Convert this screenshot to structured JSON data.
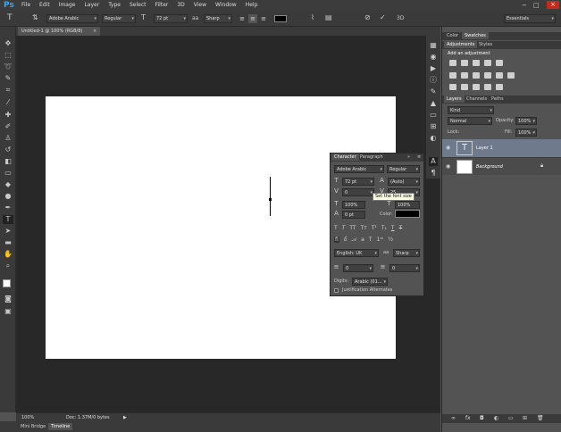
{
  "app": {
    "logo": "Ps"
  },
  "menu": [
    "File",
    "Edit",
    "Image",
    "Layer",
    "Type",
    "Select",
    "Filter",
    "3D",
    "View",
    "Window",
    "Help"
  ],
  "options_bar": {
    "font_family": "Adobe Arabic",
    "font_style": "Regular",
    "font_size": "72 pt",
    "aa_label": "aa",
    "anti_alias": "Sharp",
    "three_d": "3D",
    "workspace": "Essentials"
  },
  "document": {
    "tab_title": "Untitled-1 @ 100% (RGB/8)"
  },
  "status": {
    "zoom": "100%",
    "doc_info": "Doc: 1.37M/0 bytes"
  },
  "bottom_tabs": [
    "Mini Bridge",
    "Timeline"
  ],
  "color_panel": {
    "tabs": [
      "Color",
      "Swatches"
    ]
  },
  "adjustments_panel": {
    "tabs": [
      "Adjustments",
      "Styles"
    ],
    "title": "Add an adjustment"
  },
  "layers_panel": {
    "tabs": [
      "Layers",
      "Channels",
      "Paths"
    ],
    "kind_label": "Kind",
    "blend_mode": "Normal",
    "opacity_label": "Opacity:",
    "opacity": "100%",
    "lock_label": "Lock:",
    "fill_label": "Fill:",
    "fill": "100%",
    "layers": [
      {
        "name": "Layer 1",
        "type": "text",
        "selected": true
      },
      {
        "name": "Background",
        "type": "fill",
        "selected": false
      }
    ]
  },
  "character_panel": {
    "tabs": [
      "Character",
      "Paragraph"
    ],
    "font_family": "Adobe Arabic",
    "font_style": "Regular",
    "font_size": "72 pt",
    "leading": "(Auto)",
    "kerning": "0",
    "tracking": "25",
    "vertical_scale": "100%",
    "horizontal_scale": "100%",
    "baseline_shift": "0 pt",
    "color_label": "Color:",
    "tooltip": "Set the font size",
    "language": "English: UK",
    "aa_label": "aa",
    "anti_alias": "Sharp",
    "left_value": "0",
    "right_value": "0",
    "digits_label": "Digits:",
    "digits": "Arabic (01...",
    "justification_label": "Justification Alternates"
  }
}
